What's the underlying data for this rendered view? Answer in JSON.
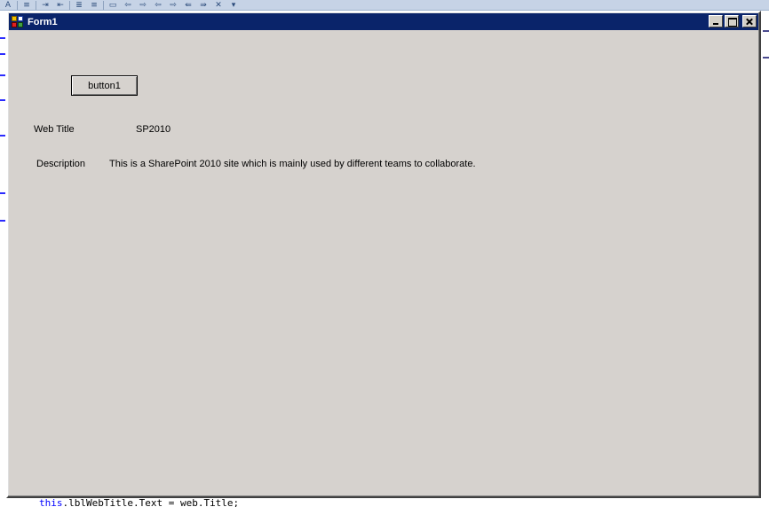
{
  "window": {
    "title": "Form1",
    "caption_buttons": {
      "minimize": "minimize-icon",
      "maximize": "maximize-icon",
      "close": "close-icon"
    }
  },
  "form": {
    "button_label": "button1",
    "web_title_caption": "Web Title",
    "web_title_value": "SP2010",
    "description_caption": "Description",
    "description_value": "This is a SharePoint 2010 site which is mainly used by different teams to collaborate."
  },
  "ide": {
    "code_keyword": "this",
    "code_rest": ".lblWebTitle.Text = web.Title;"
  },
  "colors": {
    "titlebar": "#0a246a",
    "form_background": "#d6d2ce"
  }
}
